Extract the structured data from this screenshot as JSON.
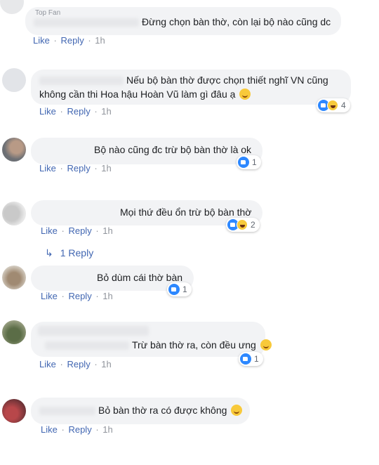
{
  "actions": {
    "like": "Like",
    "reply": "Reply",
    "dot": "·"
  },
  "top_label": "Top Fan",
  "comments": [
    {
      "text": "Đừng chọn bàn thờ, còn lại bộ nào cũng dc",
      "time": "1h"
    },
    {
      "line1": "Nếu bộ bàn thờ được chọn thiết nghĩ VN cũng",
      "line2": "không cần thi Hoa hậu Hoàn Vũ làm gì đâu ạ",
      "time": "1h",
      "reactions": "4"
    },
    {
      "text": "Bộ nào cũng đc trừ bộ bàn thờ là ok",
      "time": "1h",
      "reactions": "1"
    },
    {
      "text": "Mọi thứ đều ổn trừ bộ bàn thờ",
      "time": "1h",
      "reactions": "2",
      "replies": "1 Reply"
    },
    {
      "text": "Bỏ dùm cái thờ bàn",
      "time": "1h",
      "reactions": "1"
    },
    {
      "text": "Trừ bàn thờ ra, còn đều ưng",
      "time": "1h",
      "reactions": "1"
    },
    {
      "text": "Bỏ bàn thờ ra có được không",
      "time": "1h"
    }
  ],
  "icons": {
    "like": "like-icon",
    "haha": "haha-icon",
    "reply_arrow": "reply-arrow-icon",
    "emoji": "smiley-emoji-icon"
  },
  "colors": {
    "link": "#4267b2",
    "bubble": "#f2f3f5",
    "like_blue": "#2d88ff"
  }
}
